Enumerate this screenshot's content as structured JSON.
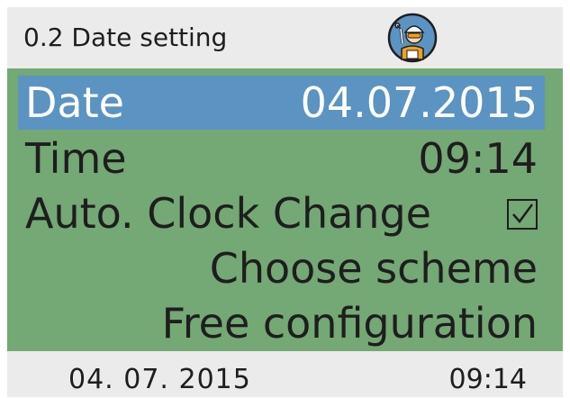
{
  "header": {
    "title": "0.2 Date setting",
    "icon": "technician-icon"
  },
  "menu": {
    "items": [
      {
        "label": "Date",
        "value": "04.07.2015",
        "selected": true
      },
      {
        "label": "Time",
        "value": "09:14",
        "selected": false
      },
      {
        "label": "Auto. Clock Change",
        "checked": true,
        "selected": false
      },
      {
        "label": "Choose scheme",
        "selected": false
      },
      {
        "label": "Free configuration",
        "selected": false
      }
    ]
  },
  "footer": {
    "date": "04. 07. 2015",
    "time": "09:14"
  },
  "colors": {
    "menu_background": "#74a874",
    "selection": "#5b93c3",
    "chrome": "#ebebeb"
  }
}
